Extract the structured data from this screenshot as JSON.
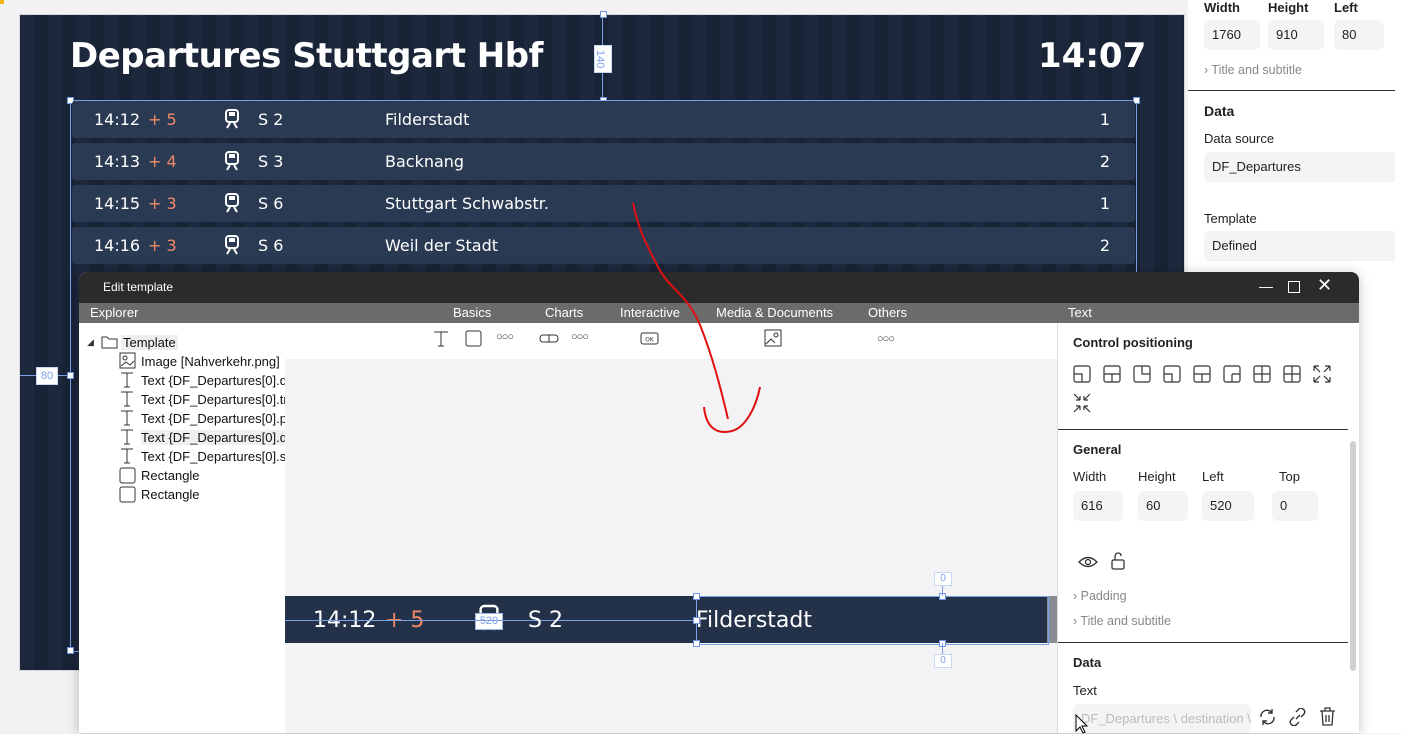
{
  "board": {
    "title": "Departures Stuttgart Hbf",
    "time": "14:07",
    "height_label": "140",
    "left_label": "80",
    "rows": [
      {
        "time": "14:12",
        "delay": "+ 5",
        "line": "S 2",
        "destination": "Filderstadt",
        "platform": "1"
      },
      {
        "time": "14:13",
        "delay": "+ 4",
        "line": "S 3",
        "destination": "Backnang",
        "platform": "2"
      },
      {
        "time": "14:15",
        "delay": "+ 3",
        "line": "S 6",
        "destination": "Stuttgart Schwabstr.",
        "platform": "1"
      },
      {
        "time": "14:16",
        "delay": "+ 3",
        "line": "S 6",
        "destination": "Weil der Stadt",
        "platform": "2"
      }
    ]
  },
  "props_bg": {
    "labels": {
      "width": "Width",
      "height": "Height",
      "left": "Left"
    },
    "values": {
      "width": "1760",
      "height": "910",
      "left": "80"
    },
    "title_subtitle": "Title and subtitle",
    "data_heading": "Data",
    "data_source_label": "Data source",
    "data_source_value": "DF_Departures",
    "template_label": "Template",
    "template_value": "Defined"
  },
  "dialog": {
    "title": "Edit template",
    "menus": {
      "explorer": "Explorer",
      "basics": "Basics",
      "charts": "Charts",
      "interactive": "Interactive",
      "media": "Media & Documents",
      "others": "Others",
      "text": "Text"
    },
    "tree": [
      {
        "label": "Template",
        "icon": "folder-icon"
      },
      {
        "label": "Image [Nahverkehr.png]",
        "icon": "image-icon"
      },
      {
        "label": "Text {DF_Departures[0].d",
        "icon": "text-icon"
      },
      {
        "label": "Text {DF_Departures[0].tr",
        "icon": "text-icon"
      },
      {
        "label": "Text {DF_Departures[0].p",
        "icon": "text-icon"
      },
      {
        "label": "Text {DF_Departures[0].d",
        "icon": "text-icon"
      },
      {
        "label": "Text {DF_Departures[0].s",
        "icon": "text-icon"
      },
      {
        "label": "Rectangle",
        "icon": "rectangle-icon"
      },
      {
        "label": "Rectangle",
        "icon": "rectangle-icon"
      }
    ],
    "preview": {
      "time": "14:12",
      "delay": "+ 5",
      "badge": "520",
      "line": "S 2",
      "destination": "Filderstadt",
      "top_label": "0",
      "bottom_label": "0"
    },
    "panel": {
      "control_positioning": "Control positioning",
      "general": "General",
      "width_label": "Width",
      "height_label": "Height",
      "left_label": "Left",
      "top_label": "Top",
      "width": "616",
      "height": "60",
      "left": "520",
      "top": "0",
      "padding": "Padding",
      "title_subtitle": "Title and subtitle",
      "data": "Data",
      "text_label": "Text",
      "text_placeholder": "DF_Departures \\ destination \\"
    }
  },
  "colors": {
    "board_bg": "#1a2438",
    "row_bg": "#2a3a52",
    "delay": "#f08a66",
    "selection": "#7aa0e8",
    "annotation": "#e01010"
  }
}
